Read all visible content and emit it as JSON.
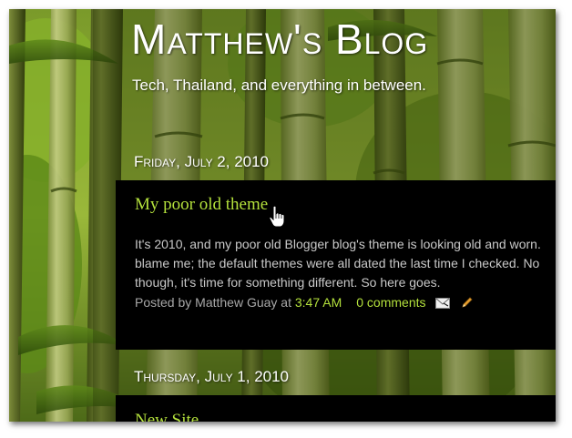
{
  "blog": {
    "title": "Matthew's Blog",
    "tagline": "Tech, Thailand, and everything in between."
  },
  "posts": [
    {
      "date": "Friday, July 2, 2010",
      "title": "My poor old theme",
      "body": [
        "It's 2010, and my poor old Blogger blog's theme is looking old and worn.",
        "blame me; the default themes were all dated the last time I checked. No",
        "though, it's time for something different. So here goes."
      ],
      "footer": {
        "posted_by": "Posted by Matthew Guay at",
        "time": "3:47 AM",
        "comments": "0 comments",
        "email_icon": "email-post-icon",
        "edit_icon": "edit-post-pencil-icon"
      }
    },
    {
      "date": "Thursday, July 1, 2010",
      "title": "New Site"
    }
  ],
  "colors": {
    "accent": "#b4e13c",
    "post_background": "#000000",
    "body_text": "#c8c8c8"
  },
  "cursor": "hand-pointer-cursor"
}
